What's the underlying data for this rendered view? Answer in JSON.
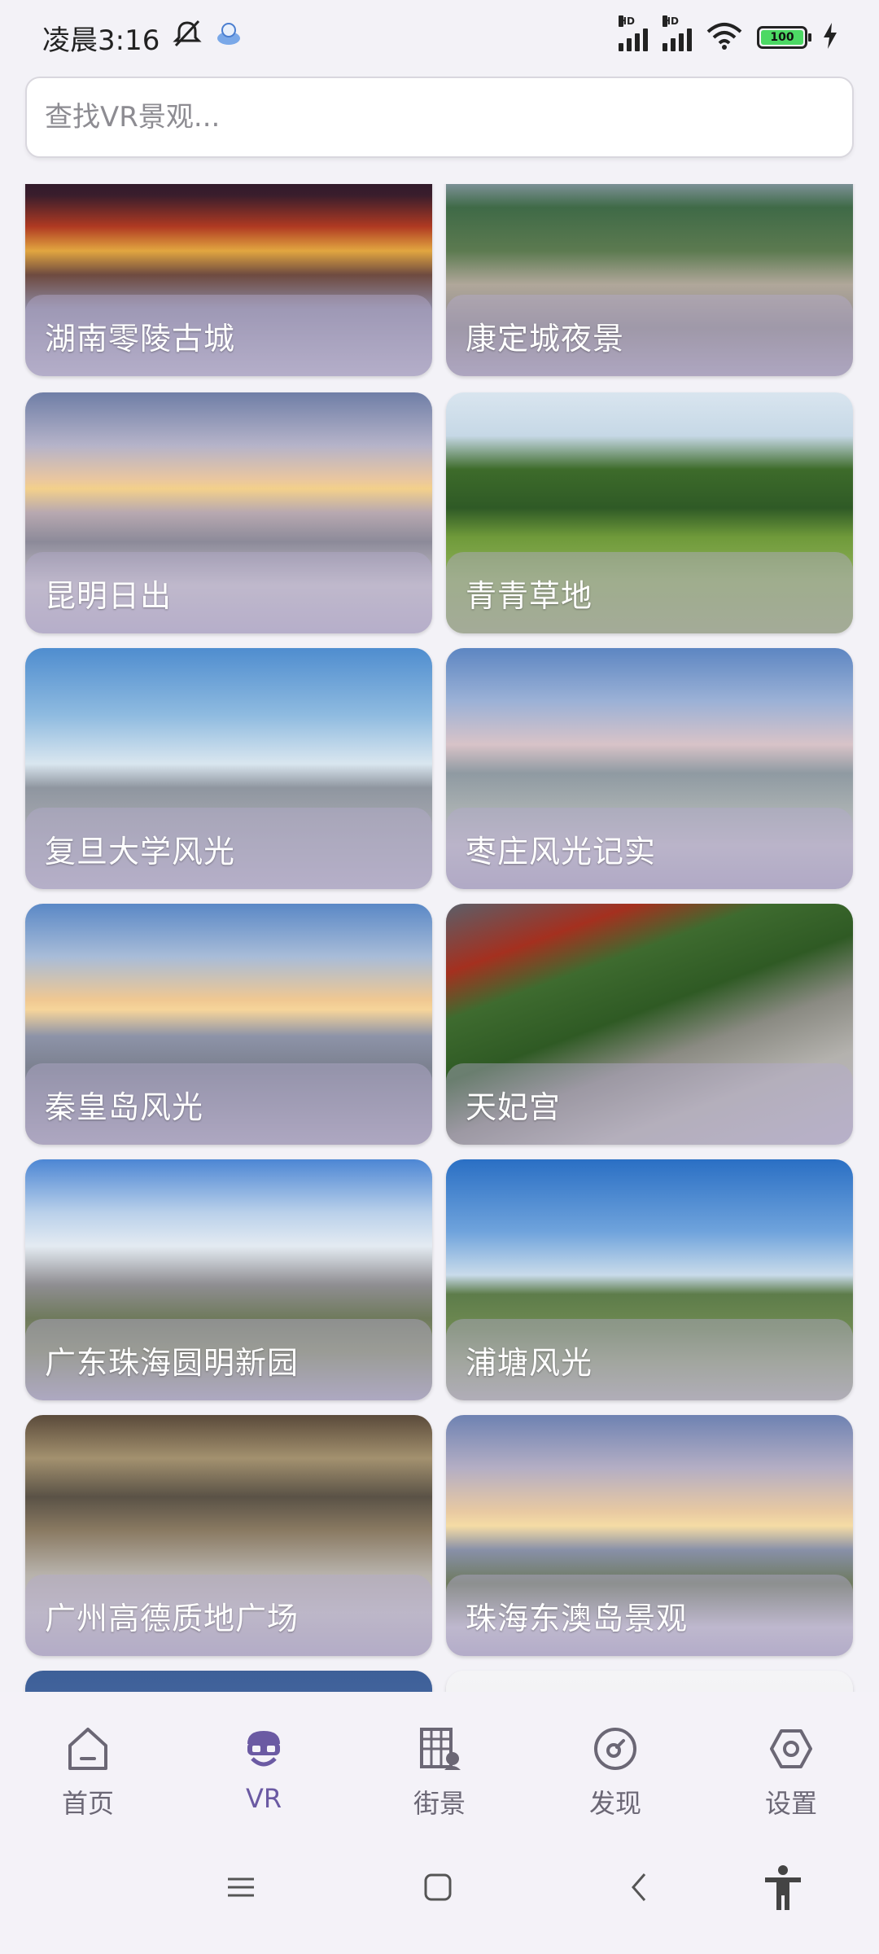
{
  "status_bar": {
    "time": "凌晨3:16",
    "battery_level": "100",
    "net_label_1": "HD",
    "net_label_2": "HD"
  },
  "search": {
    "placeholder": "查找VR景观..."
  },
  "cards": [
    {
      "label": "湖南零陵古城"
    },
    {
      "label": "康定城夜景"
    },
    {
      "label": "昆明日出"
    },
    {
      "label": "青青草地"
    },
    {
      "label": "复旦大学风光"
    },
    {
      "label": "枣庄风光记实"
    },
    {
      "label": "秦皇岛风光"
    },
    {
      "label": "天妃宫"
    },
    {
      "label": "广东珠海圆明新园"
    },
    {
      "label": "浦塘风光"
    },
    {
      "label": "广州高德质地广场"
    },
    {
      "label": "珠海东澳岛景观"
    }
  ],
  "bottom_nav": {
    "items": [
      {
        "label": "首页",
        "icon": "home-icon"
      },
      {
        "label": "VR",
        "icon": "vr-icon"
      },
      {
        "label": "街景",
        "icon": "street-view-icon"
      },
      {
        "label": "发现",
        "icon": "compass-icon"
      },
      {
        "label": "设置",
        "icon": "settings-icon"
      }
    ],
    "active_index": 1,
    "active_color": "#6b5aa3"
  }
}
